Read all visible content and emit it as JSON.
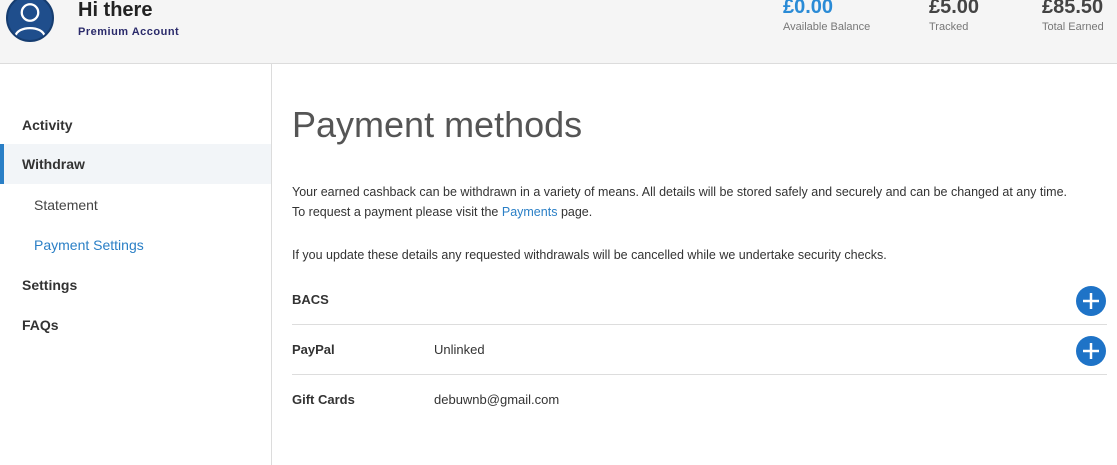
{
  "header": {
    "greeting": "Hi there",
    "account_type": "Premium Account",
    "avatar_icon": "user-icon",
    "stats": {
      "available": {
        "amount": "£0.00",
        "label": "Available Balance"
      },
      "tracked": {
        "amount": "£5.00",
        "label": "Tracked"
      },
      "total": {
        "amount": "£85.50",
        "label": "Total Earned"
      }
    }
  },
  "sidebar": {
    "activity": "Activity",
    "withdraw": "Withdraw",
    "statement": "Statement",
    "payment_settings": "Payment Settings",
    "settings": "Settings",
    "faqs": "FAQs"
  },
  "main": {
    "title": "Payment methods",
    "intro_line1": "Your earned cashback can be withdrawn in a variety of means. All details will be stored safely and securely and can be changed at any time.",
    "intro_prefix": "To request a payment please visit the",
    "intro_link": "Payments",
    "intro_suffix": "page.",
    "warning": "If you update these details any requested withdrawals will be cancelled while we undertake security checks.",
    "methods": [
      {
        "name": "BACS",
        "status": ""
      },
      {
        "name": "PayPal",
        "status": "Unlinked"
      },
      {
        "name": "Gift Cards",
        "status": "debuwnb@gmail.com"
      }
    ]
  },
  "colors": {
    "accent": "#2a7fc6",
    "balance": "#2a8bd6",
    "add_button": "#1e73c7"
  }
}
